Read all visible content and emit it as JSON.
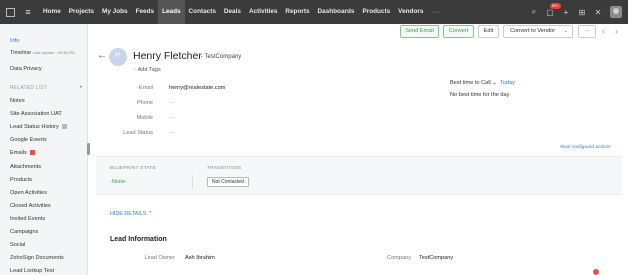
{
  "topnav": {
    "tabs": [
      "Home",
      "Projects",
      "My Jobs",
      "Feeds",
      "Leads",
      "Contacts",
      "Deals",
      "Activities",
      "Reports",
      "Dashboards",
      "Products",
      "Vendors"
    ],
    "active_tab": "Leads",
    "more_label": "···",
    "notification_badge": "99+",
    "icons": [
      "search-icon",
      "bell-icon",
      "plus-icon",
      "calendar-icon",
      "settings-icon",
      "avatar"
    ]
  },
  "sidebar": {
    "info": "Info",
    "timeline": "Timeline",
    "timeline_sub": "Last Update : 09:38 PM",
    "data_privacy": "Data Privacy",
    "related_list": "RELATED LIST",
    "items": [
      "Notes",
      "Site Association UAT",
      "Lead Status History",
      "Google Events",
      "Emails",
      "Attachments",
      "Products",
      "Open Activities",
      "Closed Activities",
      "Invited Events",
      "Campaigns",
      "Social",
      "ZohoSign Documents",
      "Lead Lookup Test"
    ]
  },
  "toolbar": {
    "send_email": "Send Email",
    "convert": "Convert",
    "edit": "Edit",
    "convert_vendor": "Convert to Vendor",
    "more": "···"
  },
  "lead": {
    "name": "Henry Fletcher",
    "company": "- TestCompany",
    "add_tags": "Add Tags"
  },
  "fields": [
    {
      "label": "Email",
      "value": "henry@realestate.com"
    },
    {
      "label": "Phone",
      "value": "—"
    },
    {
      "label": "Mobile",
      "value": "—"
    },
    {
      "label": "Lead Status",
      "value": "—"
    }
  ],
  "best_time": {
    "label": "Best time to Call",
    "day": "Today",
    "note": "No best time for the day"
  },
  "view_actions": "View configured actions",
  "blueprint": {
    "state_label": "BLUEPRINT STATE",
    "transitions_label": "TRANSITIONS",
    "state_value": "-None-",
    "transition_button": "Not Contacted"
  },
  "details": {
    "hide_label": "HIDE DETAILS",
    "section_title": "Lead Information",
    "lead_owner_label": "Lead Owner",
    "lead_owner_value": "Ash Ibrahim",
    "company_label": "Company",
    "company_value": "TestCompany"
  },
  "colors": {
    "nav_bg": "#3b3b3b",
    "accent_blue": "#2f7ed8",
    "accent_green": "#3c9b5a",
    "badge_red": "#e5413a"
  }
}
